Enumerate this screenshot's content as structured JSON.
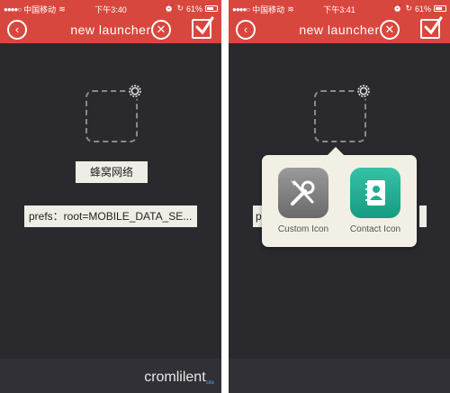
{
  "status_bar": {
    "carrier": "中国移动",
    "left_phone_time": "下午3:40",
    "right_phone_time": "下午3:41",
    "battery_percent": "61%"
  },
  "nav": {
    "title": "new launcher"
  },
  "editor": {
    "icon_name": "蜂窝网络",
    "url": "prefs：root=MOBILE_DATA_SE...",
    "url_stub": "p"
  },
  "popup": {
    "options": [
      {
        "label": "Custom Icon",
        "icon": "tools-icon"
      },
      {
        "label": "Contact Icon",
        "icon": "contact-book-icon"
      }
    ]
  },
  "watermark": {
    "brand": "cromlilent",
    "suffix": "site"
  },
  "colors": {
    "nav_red": "#d8473d",
    "background": "#2a2a2e",
    "field_bg": "#efeee6",
    "popup_bg": "#f2f0e4",
    "contact_teal": "#1fae92"
  }
}
